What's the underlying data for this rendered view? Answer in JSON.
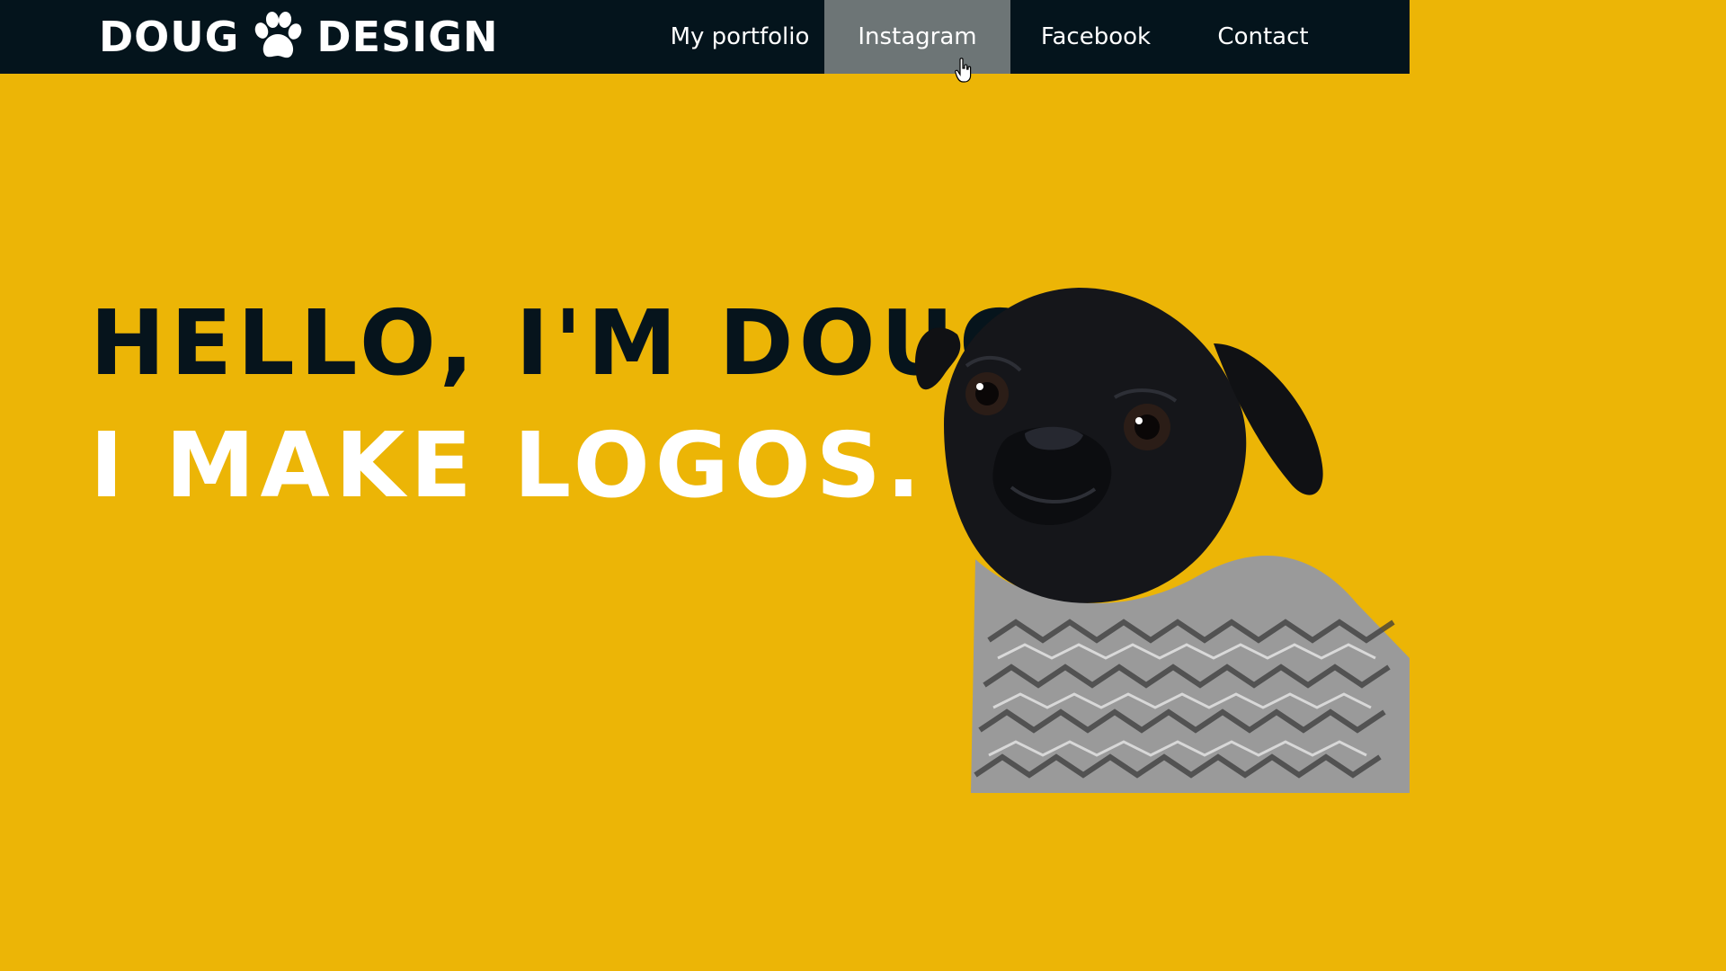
{
  "brand": {
    "word_left": "DOUG",
    "word_right": "DESIGN",
    "icon": "paw-icon"
  },
  "nav": {
    "items": [
      {
        "label": "My portfolio",
        "active": false
      },
      {
        "label": "Instagram",
        "active": true
      },
      {
        "label": "Facebook",
        "active": false
      },
      {
        "label": "Contact",
        "active": false
      }
    ]
  },
  "hero": {
    "line1": "HELLO, I'M DOUG.",
    "line2": "I MAKE LOGOS.",
    "image": "pug-in-sweater-photo"
  },
  "colors": {
    "background": "#ecb506",
    "navbar": "#04141c",
    "nav_active": "#6d7576",
    "headline_dark": "#06141c",
    "headline_light": "#ffffff"
  }
}
